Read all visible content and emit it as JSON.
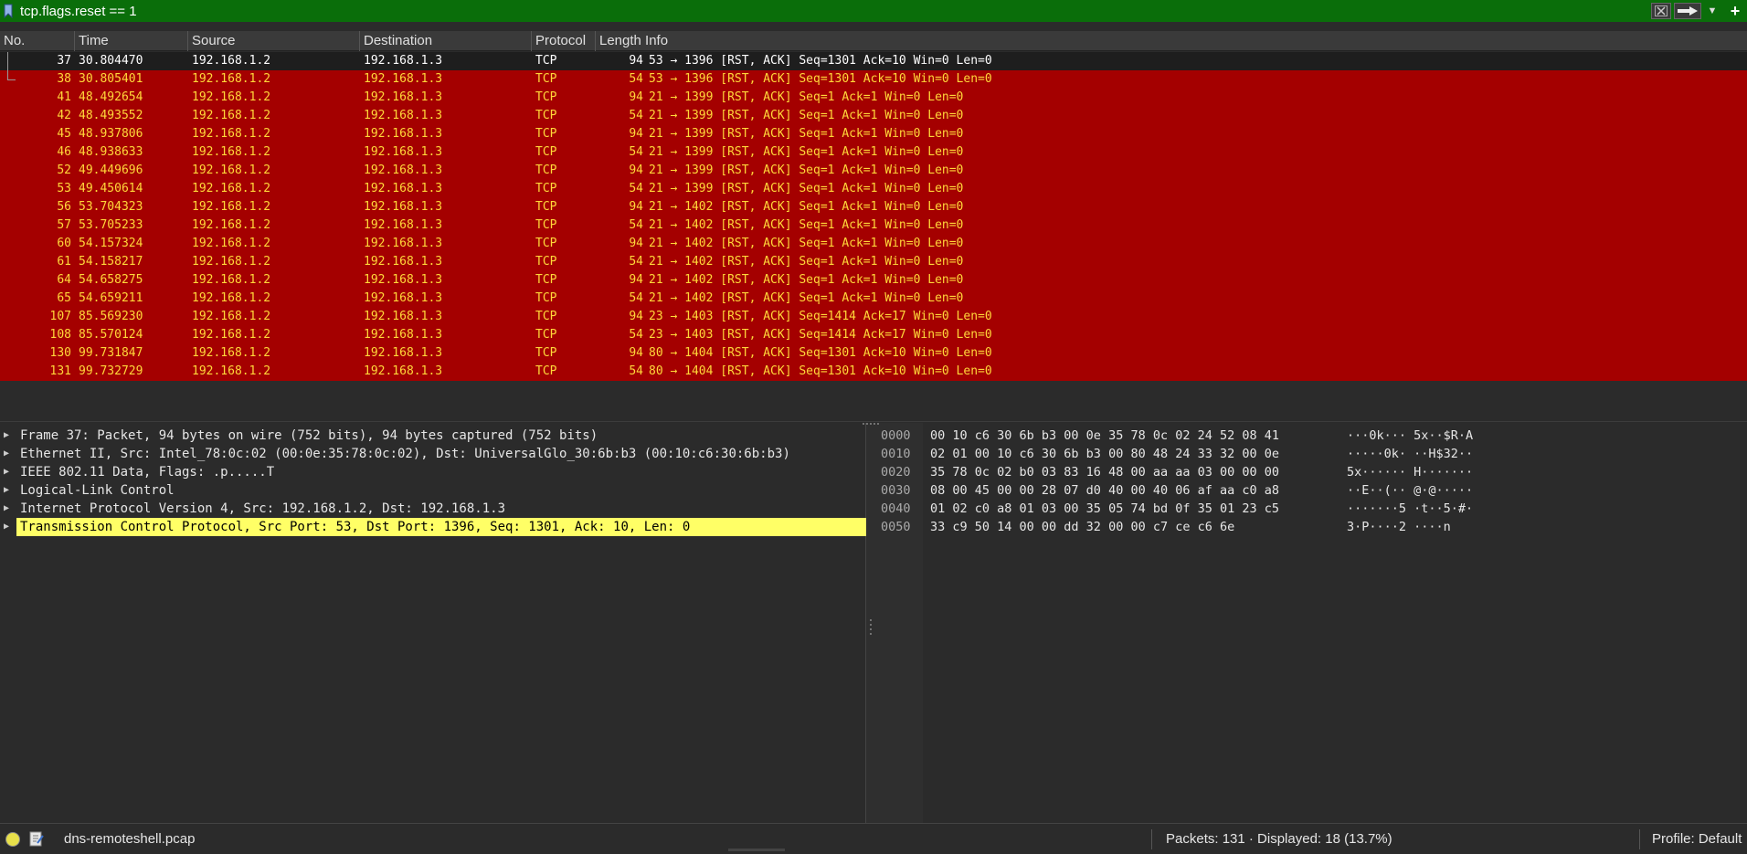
{
  "filter": {
    "value": "tcp.flags.reset == 1",
    "bar_color": "#0a6e0a"
  },
  "columns": {
    "no": "No.",
    "time": "Time",
    "source": "Source",
    "destination": "Destination",
    "protocol": "Protocol",
    "length_info": "Length Info"
  },
  "packets": [
    {
      "no": "37",
      "time": "30.804470",
      "src": "192.168.1.2",
      "dst": "192.168.1.3",
      "proto": "TCP",
      "len": "94",
      "info": "53 → 1396 [RST, ACK] Seq=1301 Ack=10 Win=0 Len=0"
    },
    {
      "no": "38",
      "time": "30.805401",
      "src": "192.168.1.2",
      "dst": "192.168.1.3",
      "proto": "TCP",
      "len": "54",
      "info": "53 → 1396 [RST, ACK] Seq=1301 Ack=10 Win=0 Len=0"
    },
    {
      "no": "41",
      "time": "48.492654",
      "src": "192.168.1.2",
      "dst": "192.168.1.3",
      "proto": "TCP",
      "len": "94",
      "info": "21 → 1399 [RST, ACK] Seq=1 Ack=1 Win=0 Len=0"
    },
    {
      "no": "42",
      "time": "48.493552",
      "src": "192.168.1.2",
      "dst": "192.168.1.3",
      "proto": "TCP",
      "len": "54",
      "info": "21 → 1399 [RST, ACK] Seq=1 Ack=1 Win=0 Len=0"
    },
    {
      "no": "45",
      "time": "48.937806",
      "src": "192.168.1.2",
      "dst": "192.168.1.3",
      "proto": "TCP",
      "len": "94",
      "info": "21 → 1399 [RST, ACK] Seq=1 Ack=1 Win=0 Len=0"
    },
    {
      "no": "46",
      "time": "48.938633",
      "src": "192.168.1.2",
      "dst": "192.168.1.3",
      "proto": "TCP",
      "len": "54",
      "info": "21 → 1399 [RST, ACK] Seq=1 Ack=1 Win=0 Len=0"
    },
    {
      "no": "52",
      "time": "49.449696",
      "src": "192.168.1.2",
      "dst": "192.168.1.3",
      "proto": "TCP",
      "len": "94",
      "info": "21 → 1399 [RST, ACK] Seq=1 Ack=1 Win=0 Len=0"
    },
    {
      "no": "53",
      "time": "49.450614",
      "src": "192.168.1.2",
      "dst": "192.168.1.3",
      "proto": "TCP",
      "len": "54",
      "info": "21 → 1399 [RST, ACK] Seq=1 Ack=1 Win=0 Len=0"
    },
    {
      "no": "56",
      "time": "53.704323",
      "src": "192.168.1.2",
      "dst": "192.168.1.3",
      "proto": "TCP",
      "len": "94",
      "info": "21 → 1402 [RST, ACK] Seq=1 Ack=1 Win=0 Len=0"
    },
    {
      "no": "57",
      "time": "53.705233",
      "src": "192.168.1.2",
      "dst": "192.168.1.3",
      "proto": "TCP",
      "len": "54",
      "info": "21 → 1402 [RST, ACK] Seq=1 Ack=1 Win=0 Len=0"
    },
    {
      "no": "60",
      "time": "54.157324",
      "src": "192.168.1.2",
      "dst": "192.168.1.3",
      "proto": "TCP",
      "len": "94",
      "info": "21 → 1402 [RST, ACK] Seq=1 Ack=1 Win=0 Len=0"
    },
    {
      "no": "61",
      "time": "54.158217",
      "src": "192.168.1.2",
      "dst": "192.168.1.3",
      "proto": "TCP",
      "len": "54",
      "info": "21 → 1402 [RST, ACK] Seq=1 Ack=1 Win=0 Len=0"
    },
    {
      "no": "64",
      "time": "54.658275",
      "src": "192.168.1.2",
      "dst": "192.168.1.3",
      "proto": "TCP",
      "len": "94",
      "info": "21 → 1402 [RST, ACK] Seq=1 Ack=1 Win=0 Len=0"
    },
    {
      "no": "65",
      "time": "54.659211",
      "src": "192.168.1.2",
      "dst": "192.168.1.3",
      "proto": "TCP",
      "len": "54",
      "info": "21 → 1402 [RST, ACK] Seq=1 Ack=1 Win=0 Len=0"
    },
    {
      "no": "107",
      "time": "85.569230",
      "src": "192.168.1.2",
      "dst": "192.168.1.3",
      "proto": "TCP",
      "len": "94",
      "info": "23 → 1403 [RST, ACK] Seq=1414 Ack=17 Win=0 Len=0"
    },
    {
      "no": "108",
      "time": "85.570124",
      "src": "192.168.1.2",
      "dst": "192.168.1.3",
      "proto": "TCP",
      "len": "54",
      "info": "23 → 1403 [RST, ACK] Seq=1414 Ack=17 Win=0 Len=0"
    },
    {
      "no": "130",
      "time": "99.731847",
      "src": "192.168.1.2",
      "dst": "192.168.1.3",
      "proto": "TCP",
      "len": "94",
      "info": "80 → 1404 [RST, ACK] Seq=1301 Ack=10 Win=0 Len=0"
    },
    {
      "no": "131",
      "time": "99.732729",
      "src": "192.168.1.2",
      "dst": "192.168.1.3",
      "proto": "TCP",
      "len": "54",
      "info": "80 → 1404 [RST, ACK] Seq=1301 Ack=10 Win=0 Len=0"
    }
  ],
  "row_colors": {
    "reset_bg": "#a40000",
    "reset_fg": "#ffd83a",
    "selected_bg": "#1e1e1e"
  },
  "details": [
    "Frame 37: Packet, 94 bytes on wire (752 bits), 94 bytes captured (752 bits)",
    "Ethernet II, Src: Intel_78:0c:02 (00:0e:35:78:0c:02), Dst: UniversalGlo_30:6b:b3 (00:10:c6:30:6b:b3)",
    "IEEE 802.11 Data, Flags: .p.....T",
    "Logical-Link Control",
    "Internet Protocol Version 4, Src: 192.168.1.2, Dst: 192.168.1.3",
    "Transmission Control Protocol, Src Port: 53, Dst Port: 1396, Seq: 1301, Ack: 10, Len: 0"
  ],
  "hex": [
    {
      "offset": "0000",
      "bytes": "00 10 c6 30 6b b3 00 0e  35 78 0c 02 24 52 08 41",
      "ascii": "···0k··· 5x··$R·A"
    },
    {
      "offset": "0010",
      "bytes": "02 01 00 10 c6 30 6b b3  00 80 48 24 33 32 00 0e",
      "ascii": "·····0k· ··H$32··"
    },
    {
      "offset": "0020",
      "bytes": "35 78 0c 02 b0 03 83 16  48 00 aa aa 03 00 00 00",
      "ascii": "5x······ H·······"
    },
    {
      "offset": "0030",
      "bytes": "08 00 45 00 00 28 07 d0  40 00 40 06 af aa c0 a8",
      "ascii": "··E··(·· @·@·····"
    },
    {
      "offset": "0040",
      "bytes": "01 02 c0 a8 01 03 00 35  05 74 bd 0f 35 01 23 c5",
      "ascii": "·······5 ·t··5·#·"
    },
    {
      "offset": "0050",
      "bytes": "33 c9 50 14 00 00 dd 32  00 00 c7 ce c6 6e",
      "ascii": "3·P····2 ····n"
    }
  ],
  "status": {
    "file": "dns-remoteshell.pcap",
    "packets": "Packets: 131 · Displayed: 18 (13.7%)",
    "profile": "Profile: Default"
  }
}
